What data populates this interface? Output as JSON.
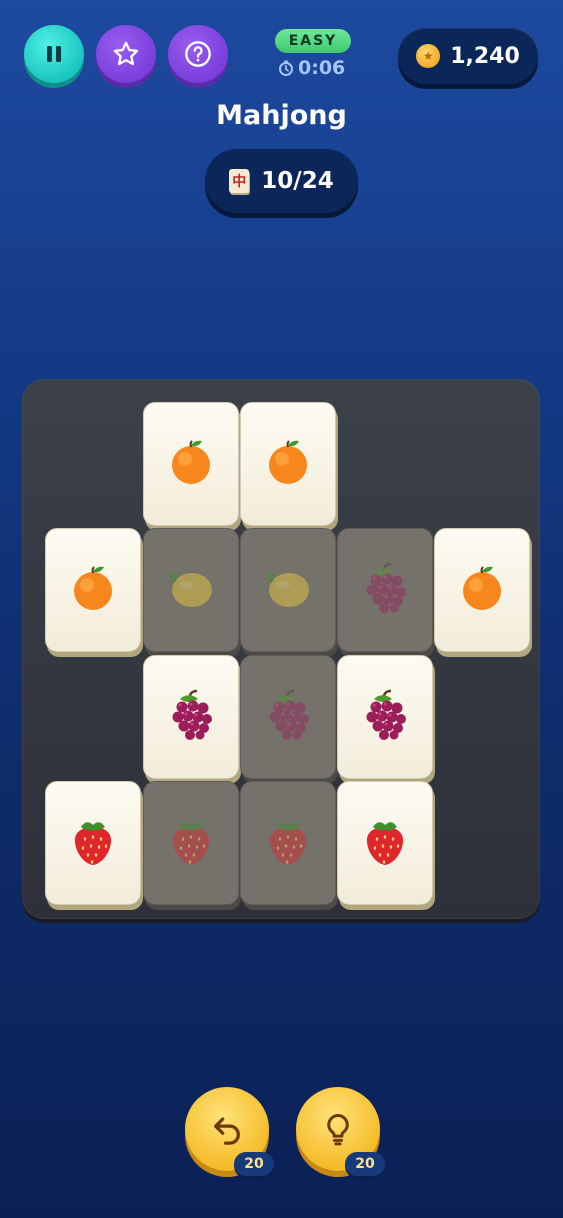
{
  "header": {
    "difficulty": "EASY",
    "timer": "0:06",
    "coins": "1,240",
    "title": "Mahjong",
    "progress_icon": "中",
    "progress": "10/24"
  },
  "icons": {
    "pause": "pause-icon",
    "star": "star-icon",
    "help": "help-icon",
    "clock": "clock-icon",
    "coin": "coin-icon",
    "undo": "undo-icon",
    "hint": "lightbulb-icon"
  },
  "board": {
    "tiles": [
      {
        "fruit": "orange",
        "state": "active"
      },
      {
        "fruit": "orange",
        "state": "active"
      },
      {
        "fruit": "orange",
        "state": "active"
      },
      {
        "fruit": "lemon",
        "state": "blocked"
      },
      {
        "fruit": "lemon",
        "state": "blocked"
      },
      {
        "fruit": "grapes",
        "state": "blocked"
      },
      {
        "fruit": "orange",
        "state": "active"
      },
      {
        "fruit": "grapes",
        "state": "active"
      },
      {
        "fruit": "grapes",
        "state": "blocked"
      },
      {
        "fruit": "grapes",
        "state": "active"
      },
      {
        "fruit": "strawberry",
        "state": "active"
      },
      {
        "fruit": "strawberry",
        "state": "blocked"
      },
      {
        "fruit": "strawberry",
        "state": "blocked"
      },
      {
        "fruit": "strawberry",
        "state": "active"
      }
    ]
  },
  "actions": {
    "undo_count": "20",
    "hint_count": "20"
  },
  "colors": {
    "teal": "#1bc6c0",
    "purple": "#7a3fdc",
    "gold": "#f5bc2a",
    "easy_green": "#3fc76e"
  }
}
